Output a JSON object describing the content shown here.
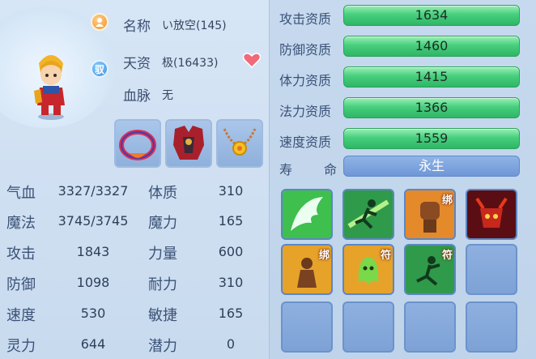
{
  "pet": {
    "name_label": "名称",
    "name_value": "い放空(145)",
    "tier_label": "天资",
    "tier_value": "极(16433)",
    "bloodline_label": "血脉",
    "bloodline_value": "无",
    "tier_icon_text": "驭"
  },
  "stats_left": [
    {
      "label": "气血",
      "value": "3327/3327"
    },
    {
      "label": "魔法",
      "value": "3745/3745"
    },
    {
      "label": "攻击",
      "value": "1843"
    },
    {
      "label": "防御",
      "value": "1098"
    },
    {
      "label": "速度",
      "value": "530"
    },
    {
      "label": "灵力",
      "value": "644"
    }
  ],
  "stats_right": [
    {
      "label": "体质",
      "value": "310"
    },
    {
      "label": "魔力",
      "value": "165"
    },
    {
      "label": "力量",
      "value": "600"
    },
    {
      "label": "耐力",
      "value": "310"
    },
    {
      "label": "敏捷",
      "value": "165"
    },
    {
      "label": "潜力",
      "value": "0"
    }
  ],
  "aptitudes": [
    {
      "label": "攻击资质",
      "value": "1634"
    },
    {
      "label": "防御资质",
      "value": "1460"
    },
    {
      "label": "体力资质",
      "value": "1415"
    },
    {
      "label": "法力资质",
      "value": "1366"
    },
    {
      "label": "速度资质",
      "value": "1559"
    }
  ],
  "life": {
    "label_a": "寿",
    "label_b": "命",
    "value": "永生"
  },
  "skills": [
    {
      "icon": "wing-icon",
      "badge": ""
    },
    {
      "icon": "running-figure-icon",
      "badge": ""
    },
    {
      "icon": "fist-icon",
      "badge": "绑"
    },
    {
      "icon": "demon-skull-icon",
      "badge": ""
    },
    {
      "icon": "monk-icon",
      "badge": "绑"
    },
    {
      "icon": "ghost-icon",
      "badge": "符"
    },
    {
      "icon": "leaping-figure-icon",
      "badge": "符"
    }
  ],
  "colors": {
    "aptitude_bar": "#47cf7e",
    "life_bar": "#6f97d6"
  }
}
